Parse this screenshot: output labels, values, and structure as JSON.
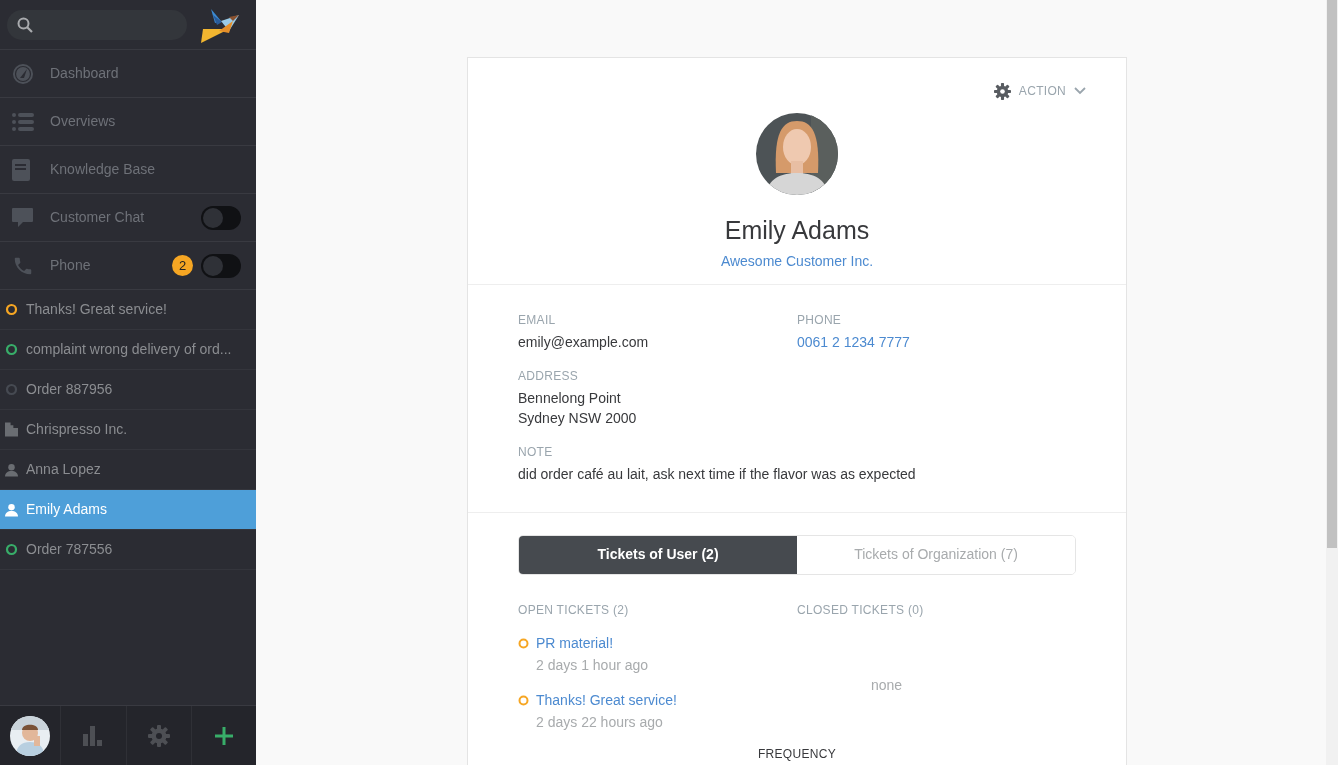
{
  "sidebar": {
    "nav": [
      {
        "kind": "dashboard",
        "label": "Dashboard"
      },
      {
        "kind": "overviews",
        "label": "Overviews"
      },
      {
        "kind": "knowledge",
        "label": "Knowledge Base"
      },
      {
        "kind": "chat",
        "label": "Customer Chat",
        "on": false
      },
      {
        "kind": "phone",
        "label": "Phone",
        "badge": "2",
        "on": false
      }
    ],
    "tasks": [
      {
        "kind": "ticket",
        "label": "Thanks! Great service!",
        "color": "#f6a623",
        "selected": false
      },
      {
        "kind": "ticket",
        "label": "complaint wrong delivery of ord...",
        "color": "#38ad69",
        "selected": false
      },
      {
        "kind": "ticket",
        "label": "Order 887956",
        "color": "#464a52",
        "selected": false
      },
      {
        "kind": "organization",
        "label": "Chrispresso Inc.",
        "selected": false
      },
      {
        "kind": "user",
        "label": "Anna Lopez",
        "selected": false
      },
      {
        "kind": "user",
        "label": "Emily Adams",
        "selected": true
      },
      {
        "kind": "ticket",
        "label": "Order 787556",
        "color": "#38ad69",
        "selected": false
      }
    ]
  },
  "profile": {
    "action": "ACTION",
    "name": "Emily Adams",
    "organization": "Awesome Customer Inc.",
    "fields": [
      {
        "label": "EMAIL",
        "lines": [
          "emily@example.com"
        ],
        "link": false
      },
      {
        "label": "PHONE",
        "lines": [
          "0061 2 1234 7777"
        ],
        "link": true
      },
      {
        "label": "ADDRESS",
        "lines": [
          "Bennelong Point",
          "Sydney NSW 2000"
        ],
        "link": false
      },
      {
        "label": "NOTE",
        "lines": [
          "did order café au lait, ask next time if the flavor was as expected"
        ],
        "link": false
      }
    ],
    "tabs": [
      {
        "label": "Tickets of User (2)",
        "selected": true
      },
      {
        "label": "Tickets of Organization (7)",
        "selected": false
      }
    ],
    "open": {
      "title": "OPEN TICKETS (2)",
      "tickets": [
        {
          "title": "PR material!",
          "time": "2 days 1 hour ago",
          "color": "#f6a623"
        },
        {
          "title": "Thanks! Great service!",
          "time": "2 days 22 hours ago",
          "color": "#f6a623"
        }
      ]
    },
    "closed": {
      "title": "CLOSED TICKETS (0)",
      "empty": "none"
    },
    "next_heading": "FREQUENCY"
  }
}
